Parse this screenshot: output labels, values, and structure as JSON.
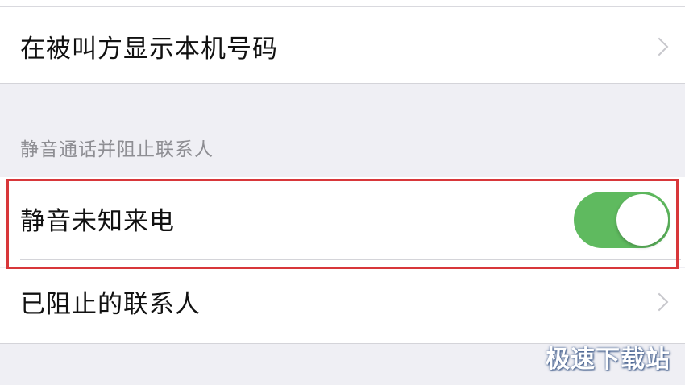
{
  "settings": {
    "show_caller_id_label": "在被叫方显示本机号码",
    "section_header": "静音通话并阻止联系人",
    "silence_unknown_callers_label": "静音未知来电",
    "silence_unknown_callers_enabled": true,
    "blocked_contacts_label": "已阻止的联系人"
  },
  "colors": {
    "toggle_on": "#5fba5f",
    "highlight_border": "#d8373a",
    "background": "#efeff4"
  },
  "watermark": {
    "text": "极速下载站"
  },
  "icons": {
    "row_chevron": "chevron-right-icon"
  }
}
